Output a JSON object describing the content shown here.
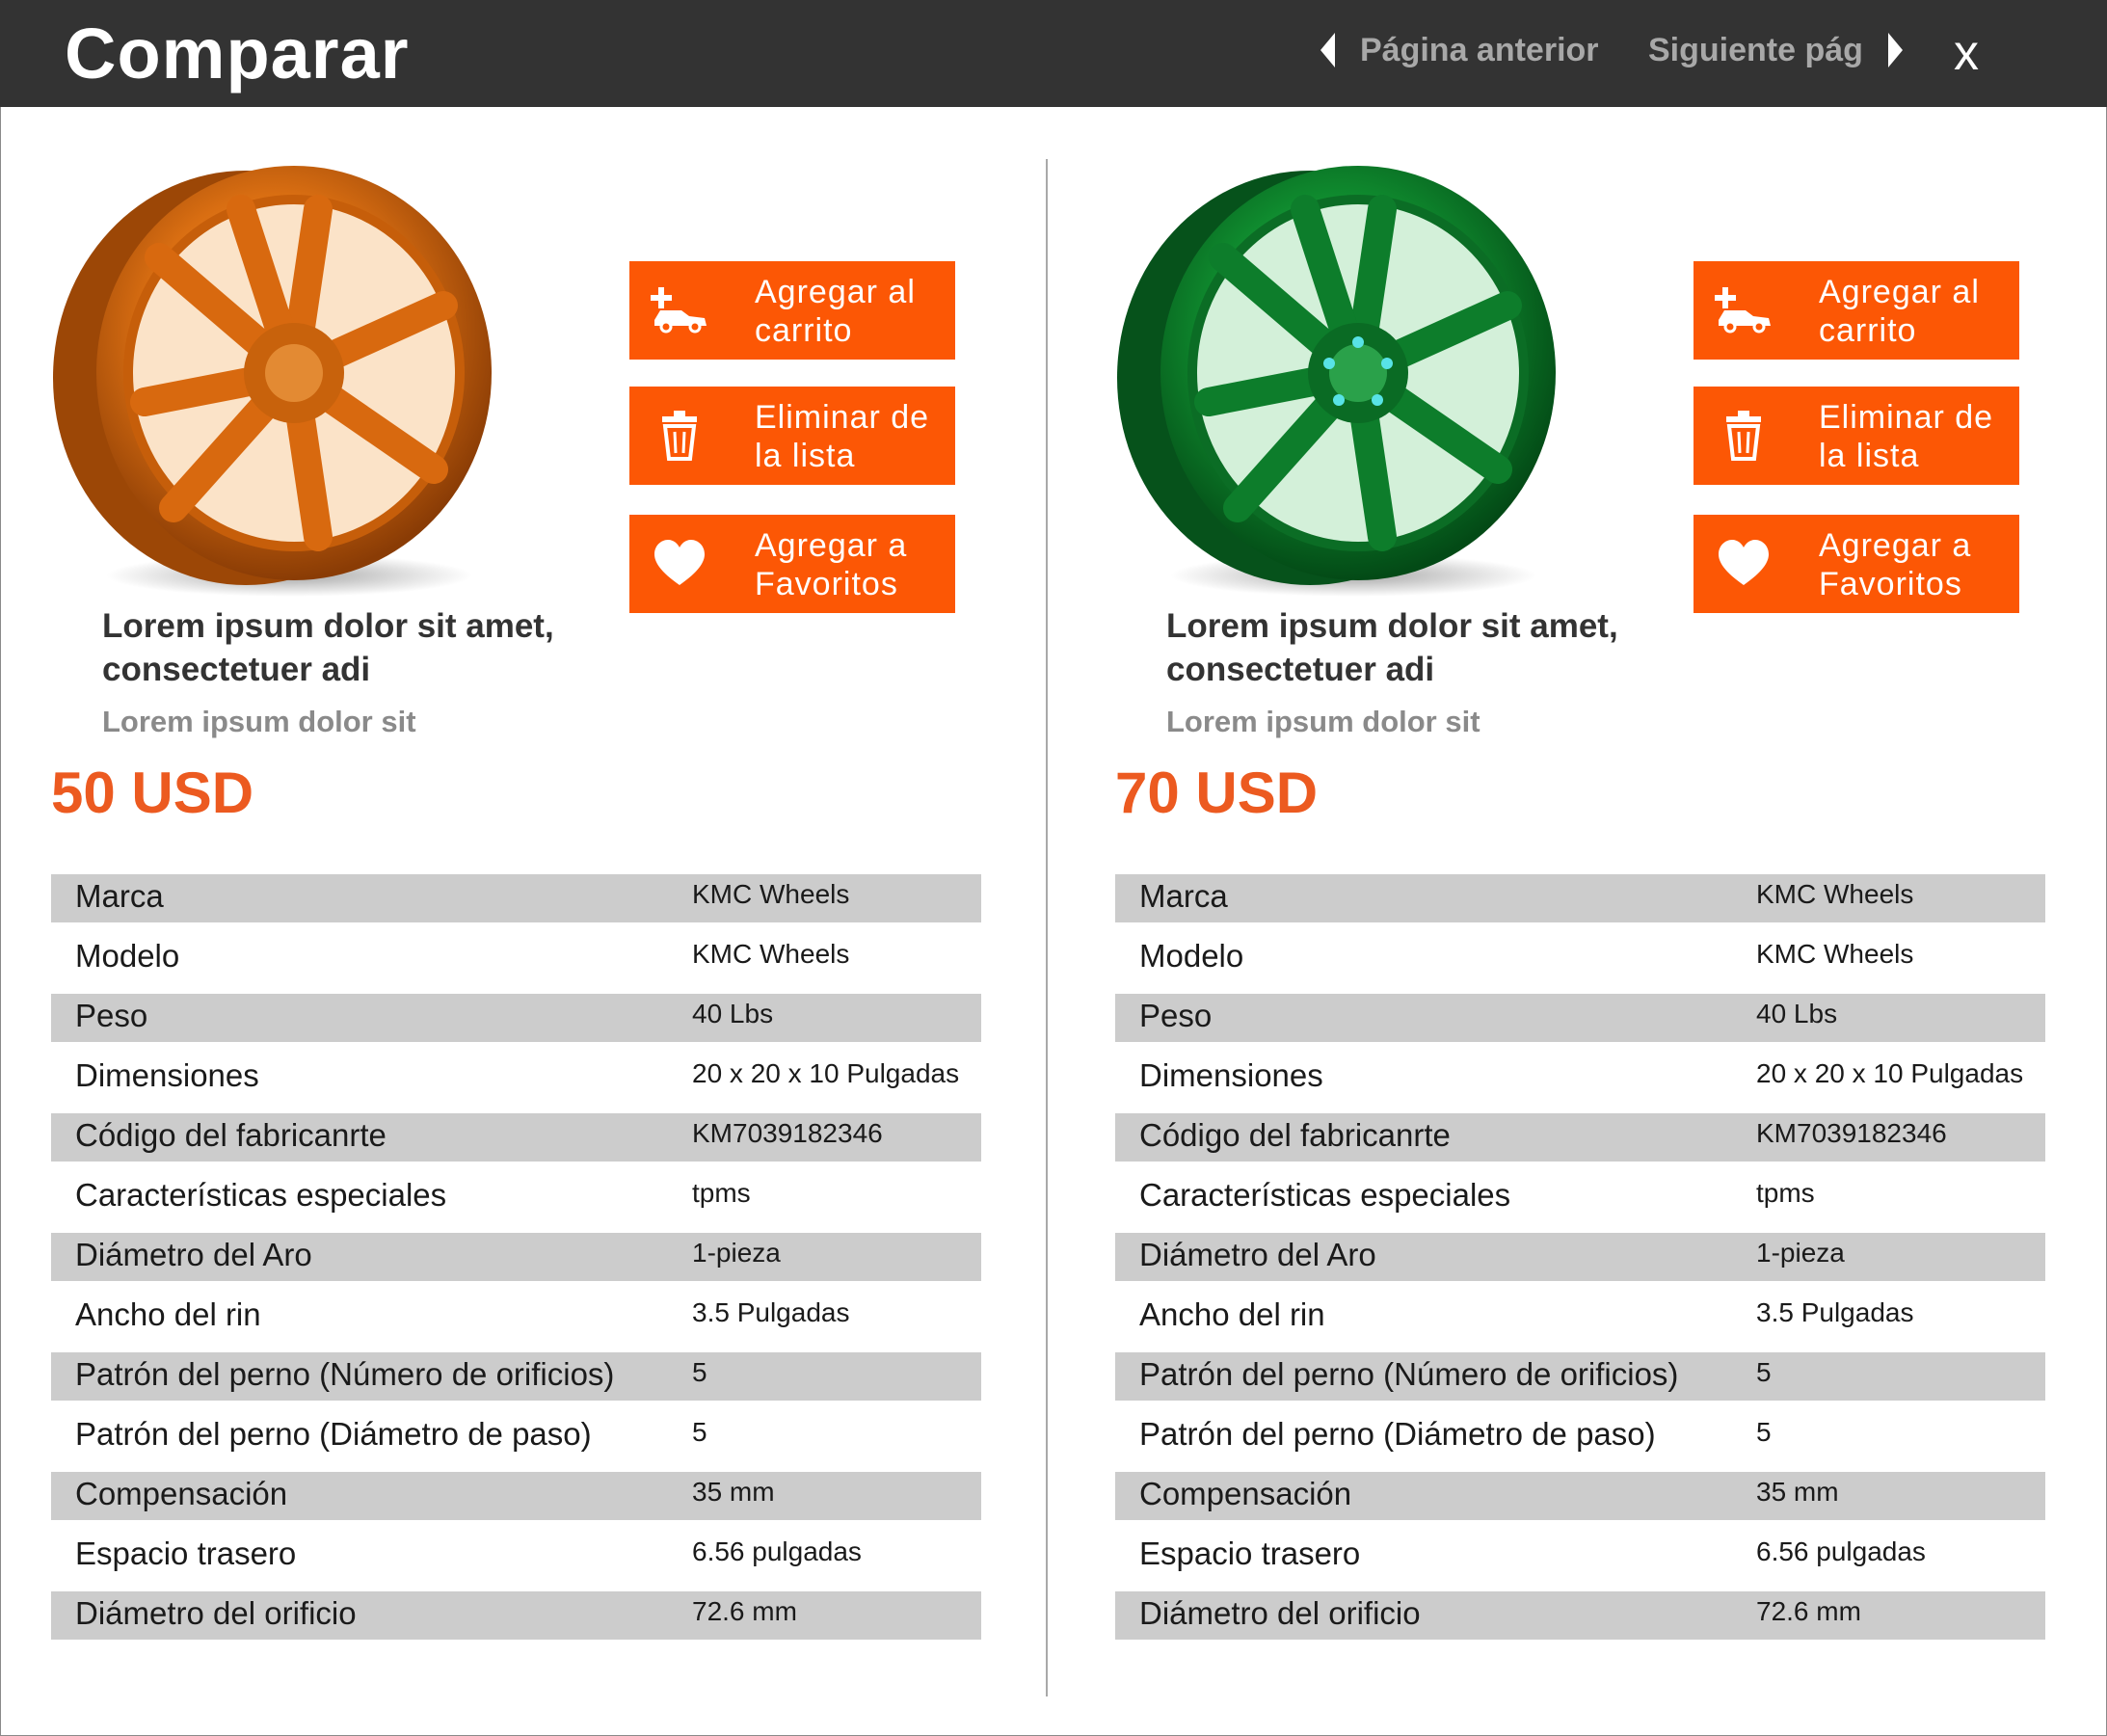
{
  "header": {
    "title": "Comparar",
    "prev_label": "Página anterior",
    "next_label": "Siguiente pág",
    "close_label": "x"
  },
  "colors": {
    "header_bg": "#333333",
    "accent": "#fc5705",
    "price": "#ec5a20",
    "row_shade": "#cccccc"
  },
  "products": [
    {
      "wheel_color": "orange",
      "buttons": {
        "cart": "Agregar al carrito",
        "remove": "Eliminar de la lista",
        "favorite": "Agregar a Favoritos"
      },
      "name": "Lorem ipsum dolor sit amet, consectetuer adi",
      "subtitle": "Lorem ipsum dolor sit",
      "price": "50 USD",
      "specs": [
        {
          "label": "Marca",
          "value": "KMC Wheels"
        },
        {
          "label": "Modelo",
          "value": "KMC Wheels"
        },
        {
          "label": "Peso",
          "value": "40 Lbs"
        },
        {
          "label": "Dimensiones",
          "value": "20 x 20 x 10  Pulgadas"
        },
        {
          "label": "Código del fabricanrte",
          "value": "KM7039182346"
        },
        {
          "label": "Características especiales",
          "value": "tpms"
        },
        {
          "label": "Diámetro del Aro",
          "value": "1-pieza"
        },
        {
          "label": "Ancho del rin",
          "value": "3.5 Pulgadas"
        },
        {
          "label": "Patrón del perno (Número de orificios)",
          "value": "5"
        },
        {
          "label": "Patrón del perno (Diámetro de paso)",
          "value": "5"
        },
        {
          "label": "Compensación",
          "value": "35 mm"
        },
        {
          "label": "Espacio trasero",
          "value": "6.56 pulgadas"
        },
        {
          "label": "Diámetro del orificio",
          "value": "72.6 mm"
        }
      ]
    },
    {
      "wheel_color": "green",
      "buttons": {
        "cart": "Agregar al carrito",
        "remove": "Eliminar de la lista",
        "favorite": "Agregar a Favoritos"
      },
      "name": "Lorem ipsum dolor sit amet, consectetuer adi",
      "subtitle": "Lorem ipsum dolor sit",
      "price": "70 USD",
      "specs": [
        {
          "label": "Marca",
          "value": "KMC Wheels"
        },
        {
          "label": "Modelo",
          "value": "KMC Wheels"
        },
        {
          "label": "Peso",
          "value": "40 Lbs"
        },
        {
          "label": "Dimensiones",
          "value": "20 x 20 x 10  Pulgadas"
        },
        {
          "label": "Código del fabricanrte",
          "value": "KM7039182346"
        },
        {
          "label": "Características especiales",
          "value": "tpms"
        },
        {
          "label": "Diámetro del Aro",
          "value": "1-pieza"
        },
        {
          "label": "Ancho del rin",
          "value": "3.5 Pulgadas"
        },
        {
          "label": "Patrón del perno (Número de orificios)",
          "value": "5"
        },
        {
          "label": "Patrón del perno (Diámetro de paso)",
          "value": "5"
        },
        {
          "label": "Compensación",
          "value": "35 mm"
        },
        {
          "label": "Espacio trasero",
          "value": "6.56 pulgadas"
        },
        {
          "label": "Diámetro del orificio",
          "value": "72.6 mm"
        }
      ]
    }
  ]
}
